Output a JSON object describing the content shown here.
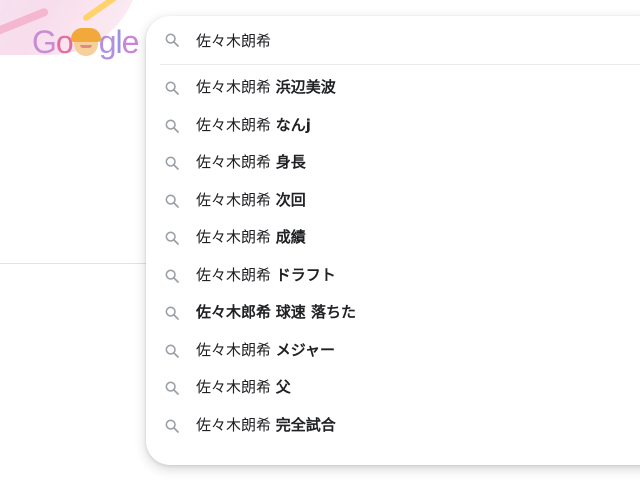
{
  "logo": {
    "letters": [
      "G",
      "o",
      "g",
      "l",
      "e"
    ]
  },
  "search": {
    "query": "佐々木朗希",
    "icon": "search-icon"
  },
  "suggestions": [
    {
      "prefix": "佐々木朗希",
      "suffix": "浜辺美波"
    },
    {
      "prefix": "佐々木朗希",
      "suffix": "なんj"
    },
    {
      "prefix": "佐々木朗希",
      "suffix": "身長"
    },
    {
      "prefix": "佐々木朗希",
      "suffix": "次回"
    },
    {
      "prefix": "佐々木朗希",
      "suffix": "成績"
    },
    {
      "prefix": "佐々木朗希",
      "suffix": "ドラフト"
    },
    {
      "prefix": "佐々木郎希",
      "suffix": "球速 落ちた"
    },
    {
      "prefix": "佐々木朗希",
      "suffix": "メジャー"
    },
    {
      "prefix": "佐々木朗希",
      "suffix": "父"
    },
    {
      "prefix": "佐々木朗希",
      "suffix": "完全試合"
    }
  ],
  "colors": {
    "icon_gray": "#9aa0a6",
    "text": "#202124",
    "panel_border": "#e8eaed"
  }
}
